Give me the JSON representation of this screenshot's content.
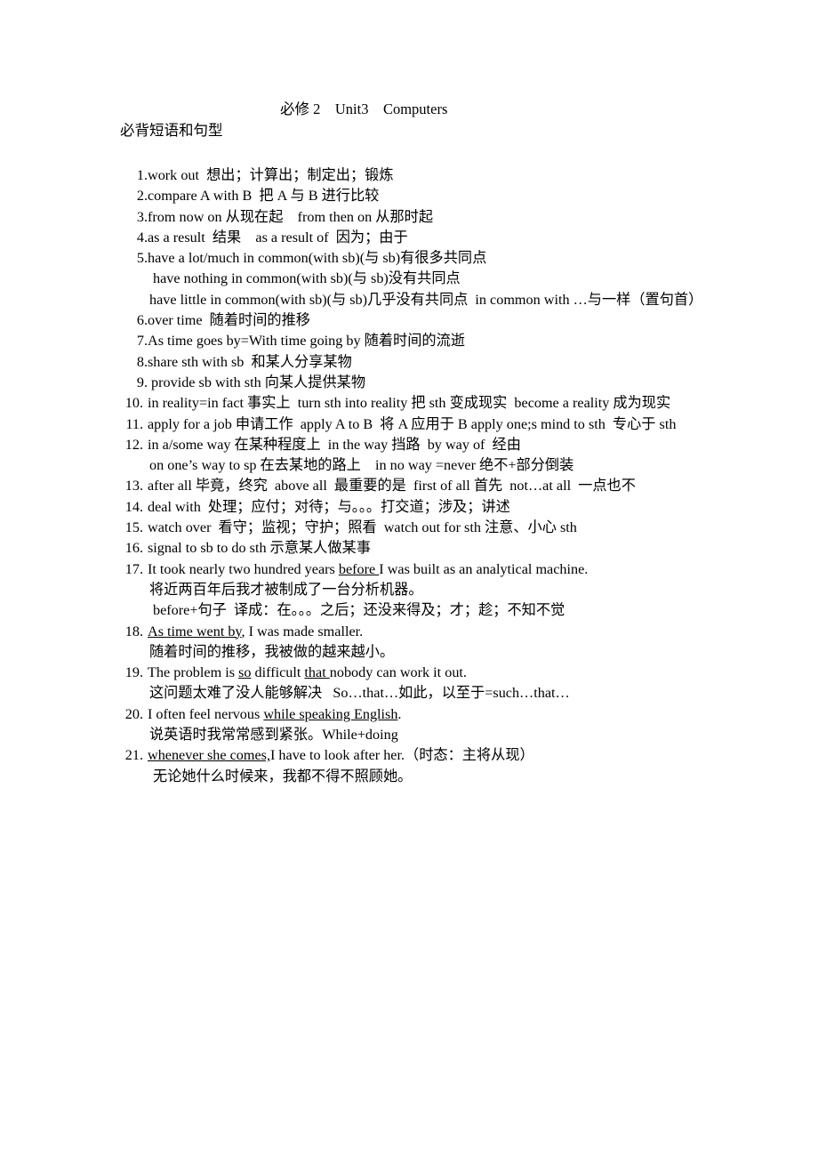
{
  "document": {
    "title": "必修 2    Unit3    Computers",
    "subtitle": "必背短语和句型",
    "items": [
      {
        "number": "1.",
        "lines": [
          {
            "text": "work out  想出；计算出；制定出；锻炼",
            "indent": "main"
          }
        ]
      },
      {
        "number": "2.",
        "lines": [
          {
            "text": "compare A with B  把 A 与 B 进行比较",
            "indent": "main"
          }
        ]
      },
      {
        "number": "3.",
        "lines": [
          {
            "text": "from now on 从现在起    from then on 从那时起",
            "indent": "main"
          }
        ]
      },
      {
        "number": "4.",
        "lines": [
          {
            "text": "as a result  结果    as a result of  因为；由于",
            "indent": "main"
          }
        ]
      },
      {
        "number": "5.",
        "lines": [
          {
            "text": "have a lot/much in common(with sb)(与 sb)有很多共同点",
            "indent": "main"
          },
          {
            "text": "have nothing in common(with sb)(与 sb)没有共同点",
            "indent": "cont-deep"
          },
          {
            "text": "have little in common(with sb)(与 sb)几乎没有共同点  in common with …与一样（置句首）",
            "indent": "cont"
          }
        ]
      },
      {
        "number": "6.",
        "lines": [
          {
            "text": "over time  随着时间的推移",
            "indent": "main"
          }
        ]
      },
      {
        "number": "7.",
        "lines": [
          {
            "text": "As time goes by=With time going by 随着时间的流逝",
            "indent": "main"
          }
        ]
      },
      {
        "number": "8.",
        "lines": [
          {
            "text": "share sth with sb  和某人分享某物",
            "indent": "main"
          }
        ]
      },
      {
        "number": "9.",
        "lines": [
          {
            "text": " provide sb with sth 向某人提供某物",
            "indent": "main"
          }
        ]
      },
      {
        "number": "10.",
        "lines": [
          {
            "text": "in reality=in fact 事实上  turn sth into reality 把 sth 变成现实  become a reality 成为现实",
            "indent": "main"
          }
        ]
      },
      {
        "number": "11.",
        "lines": [
          {
            "text": "apply for a job 申请工作  apply A to B  将 A 应用于 B apply one;s mind to sth  专心于 sth",
            "indent": "main"
          }
        ]
      },
      {
        "number": "12.",
        "lines": [
          {
            "text": "in a/some way 在某种程度上  in the way 挡路  by way of  经由",
            "indent": "main"
          },
          {
            "text": "on one’s way to sp 在去某地的路上    in no way =never 绝不+部分倒装",
            "indent": "cont"
          }
        ]
      },
      {
        "number": "13.",
        "lines": [
          {
            "text": "after all 毕竟，终究  above all  最重要的是  first of all 首先  not…at all  一点也不",
            "indent": "main"
          }
        ]
      },
      {
        "number": "14.",
        "lines": [
          {
            "text": "deal with  处理；应付；对待；与。。。打交道；涉及；讲述",
            "indent": "main"
          }
        ]
      },
      {
        "number": "15.",
        "lines": [
          {
            "text": "watch over  看守；监视；守护；照看  watch out for sth 注意、小心 sth",
            "indent": "main"
          }
        ]
      },
      {
        "number": "16.",
        "lines": [
          {
            "text": "signal to sb to do sth 示意某人做某事",
            "indent": "main"
          }
        ]
      },
      {
        "number": "17.",
        "lines": [
          {
            "html": "It took nearly two hundred years <u>before </u>I was built as an analytical machine.",
            "indent": "main"
          },
          {
            "text": "将近两百年后我才被制成了一台分析机器。",
            "indent": "cont"
          },
          {
            "text": "before+句子  译成：在。。。之后；还没来得及；才；趁；不知不觉",
            "indent": "cont-deep"
          }
        ]
      },
      {
        "number": "18.",
        "lines": [
          {
            "html": "<u>As time went by</u>, I was made smaller.",
            "indent": "main"
          },
          {
            "text": "随着时间的推移，我被做的越来越小。",
            "indent": "cont"
          }
        ]
      },
      {
        "number": "19.",
        "lines": [
          {
            "html": "The problem is <u>so</u> difficult <u>that </u>nobody can work it out.",
            "indent": "main"
          },
          {
            "text": "这问题太难了没人能够解决   So…that…如此，以至于=such…that…",
            "indent": "cont"
          }
        ]
      },
      {
        "number": "20.",
        "lines": [
          {
            "html": "I often feel nervous <u>while speaking English</u>.",
            "indent": "main"
          },
          {
            "text": "说英语时我常常感到紧张。While+doing",
            "indent": "cont"
          }
        ]
      },
      {
        "number": "21.",
        "lines": [
          {
            "html": "<u>whenever she comes,</u>I have to look after her.（时态：主将从现）",
            "indent": "main"
          },
          {
            "text": "无论她什么时候来，我都不得不照顾她。",
            "indent": "cont-deep"
          }
        ]
      }
    ]
  }
}
